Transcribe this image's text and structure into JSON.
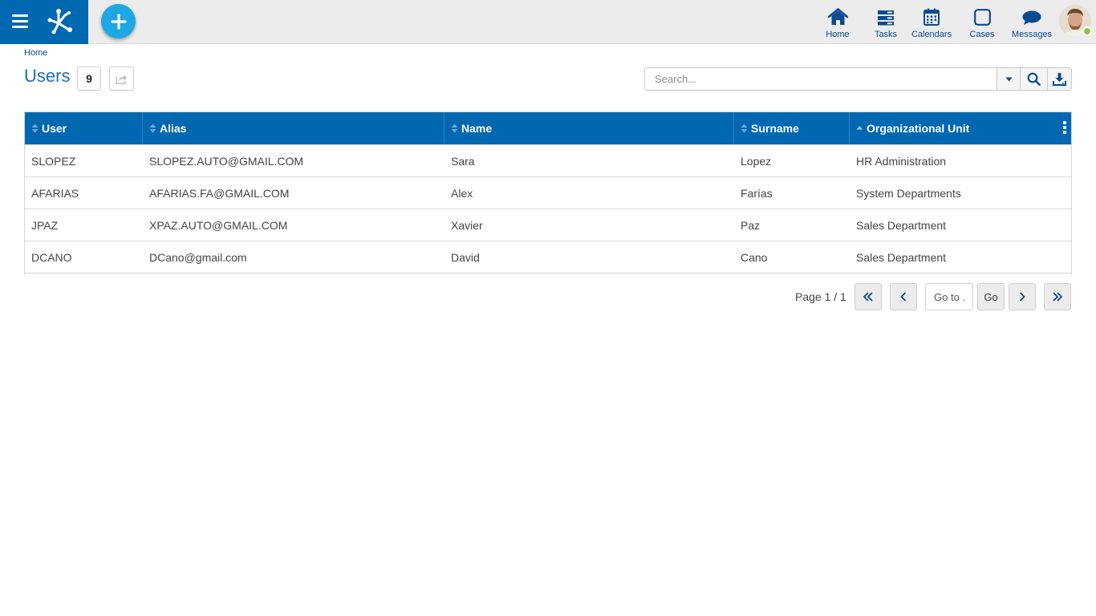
{
  "nav": {
    "items": [
      {
        "label": "Home",
        "icon": "home-icon"
      },
      {
        "label": "Tasks",
        "icon": "tasks-icon"
      },
      {
        "label": "Calendars",
        "icon": "calendar-icon"
      },
      {
        "label": "Cases",
        "icon": "cases-icon"
      },
      {
        "label": "Messages",
        "icon": "messages-icon"
      }
    ]
  },
  "breadcrumb": {
    "home": "Home"
  },
  "page": {
    "title": "Users",
    "count": "9"
  },
  "search": {
    "placeholder": "Search..."
  },
  "table": {
    "columns": [
      "User",
      "Alias",
      "Name",
      "Surname",
      "Organizational Unit"
    ],
    "rows": [
      [
        "SLOPEZ",
        "SLOPEZ.AUTO@GMAIL.COM",
        "Sara",
        "Lopez",
        "HR Administration"
      ],
      [
        "AFARIAS",
        "AFARIAS.FA@GMAIL.COM",
        "Alex",
        "Farías",
        "System Departments"
      ],
      [
        "JPAZ",
        "XPAZ.AUTO@GMAIL.COM",
        "Xavier",
        "Paz",
        "Sales Department"
      ],
      [
        "DCANO",
        "DCano@gmail.com",
        "David",
        "Cano",
        "Sales Department"
      ]
    ]
  },
  "pager": {
    "info": "Page 1 / 1",
    "goto_placeholder": "Go to ...",
    "go_label": "Go"
  },
  "colors": {
    "brand": "#0067b1",
    "accent": "#1ea7e4",
    "nav_text": "#0b4a8f",
    "online": "#8cc63f"
  }
}
